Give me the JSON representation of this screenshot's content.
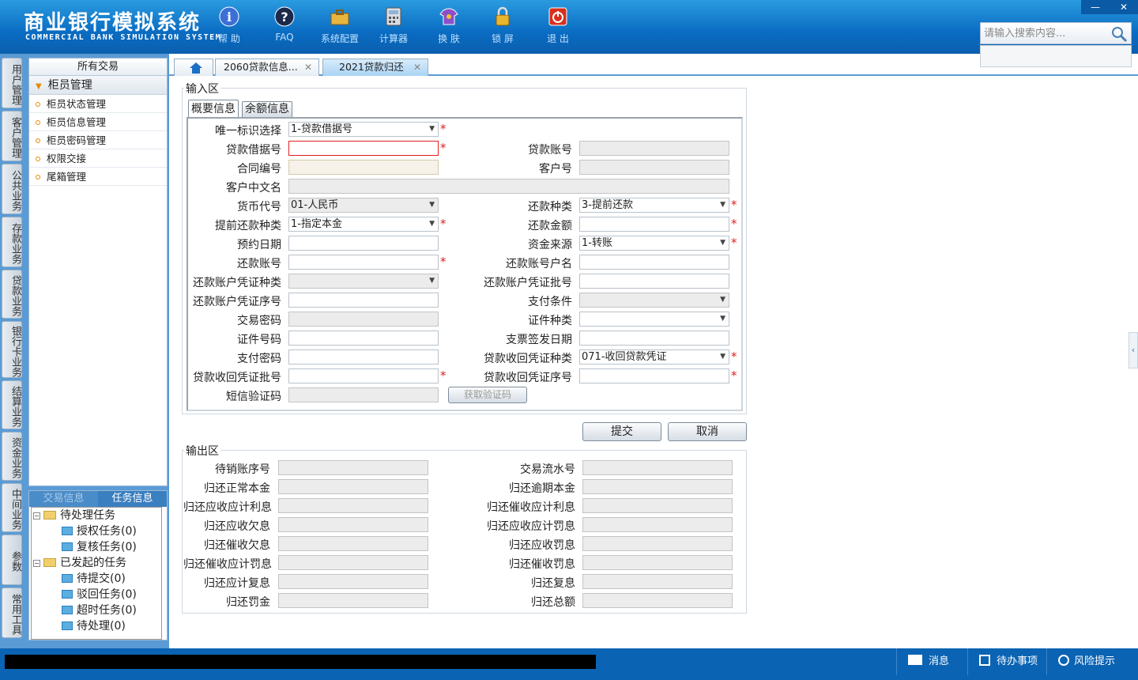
{
  "header": {
    "title_cn": "商业银行模拟系统",
    "title_en": "COMMERCIAL BANK SIMULATION SYSTEM",
    "toolbar": [
      {
        "label": "帮 助",
        "icon": "info-icon"
      },
      {
        "label": "FAQ",
        "icon": "question-icon"
      },
      {
        "label": "系统配置",
        "icon": "toolbox-icon"
      },
      {
        "label": "计算器",
        "icon": "calculator-icon"
      },
      {
        "label": "换 肤",
        "icon": "shirt-icon"
      },
      {
        "label": "锁 屏",
        "icon": "lock-icon"
      },
      {
        "label": "退 出",
        "icon": "power-icon"
      }
    ],
    "search_placeholder": "请输入搜索内容..."
  },
  "vtabs": [
    "用户管理",
    "客户管理",
    "公共业务",
    "存款业务",
    "贷款业务",
    "银行卡业务",
    "结算业务",
    "资金业务",
    "中间业务",
    "参数",
    "常用工具"
  ],
  "left_panel": {
    "title": "所有交易",
    "group": "柜员管理",
    "items": [
      "柜员状态管理",
      "柜员信息管理",
      "柜员密码管理",
      "权限交接",
      "尾箱管理"
    ],
    "task_tabs": [
      "交易信息",
      "任务信息"
    ],
    "tree": {
      "pending": "待处理任务",
      "pending_children": [
        "授权任务(0)",
        "复核任务(0)"
      ],
      "initiated": "已发起的任务",
      "initiated_children": [
        "待提交(0)",
        "驳回任务(0)",
        "超时任务(0)",
        "待处理(0)"
      ]
    }
  },
  "tabs": [
    {
      "label": "2060贷款信息..."
    },
    {
      "label": "2021贷款归还"
    }
  ],
  "input_area": {
    "title": "输入区",
    "subtabs": [
      "概要信息",
      "余额信息"
    ],
    "fields": {
      "uid_label": "唯一标识选择",
      "uid_value": "1-贷款借据号",
      "loan_no_label": "贷款借据号",
      "loan_acct_label": "贷款账号",
      "contract_label": "合同编号",
      "cust_no_label": "客户号",
      "cust_name_label": "客户中文名",
      "currency_label": "货币代号",
      "currency_value": "01-人民币",
      "repay_type_label": "还款种类",
      "repay_type_value": "3-提前还款",
      "prepay_type_label": "提前还款种类",
      "prepay_type_value": "1-指定本金",
      "repay_amt_label": "还款金额",
      "appt_date_label": "预约日期",
      "fund_src_label": "资金来源",
      "fund_src_value": "1-转账",
      "repay_acct_label": "还款账号",
      "repay_acct_name_label": "还款账号户名",
      "voucher_type_label": "还款账户凭证种类",
      "voucher_batch_label": "还款账户凭证批号",
      "voucher_seq_label": "还款账户凭证序号",
      "pay_cond_label": "支付条件",
      "txn_pwd_label": "交易密码",
      "id_type_label": "证件种类",
      "id_no_label": "证件号码",
      "check_date_label": "支票签发日期",
      "pay_pwd_label": "支付密码",
      "recv_voucher_type_label": "贷款收回凭证种类",
      "recv_voucher_type_value": "071-收回贷款凭证",
      "recv_voucher_batch_label": "贷款收回凭证批号",
      "recv_voucher_seq_label": "贷款收回凭证序号",
      "sms_label": "短信验证码",
      "sms_btn": "获取验证码"
    }
  },
  "actions": {
    "submit": "提交",
    "cancel": "取消"
  },
  "output_area": {
    "title": "输出区",
    "left": [
      "待销账序号",
      "归还正常本金",
      "归还应收应计利息",
      "归还应收欠息",
      "归还催收欠息",
      "归还催收应计罚息",
      "归还应计复息",
      "归还罚金"
    ],
    "right": [
      "交易流水号",
      "归还逾期本金",
      "归还催收应计利息",
      "归还应收应计罚息",
      "归还应收罚息",
      "归还催收罚息",
      "归还复息",
      "归还总额"
    ]
  },
  "status_bar": {
    "messages": "消息",
    "todo": "待办事项",
    "risk": "风险提示"
  }
}
